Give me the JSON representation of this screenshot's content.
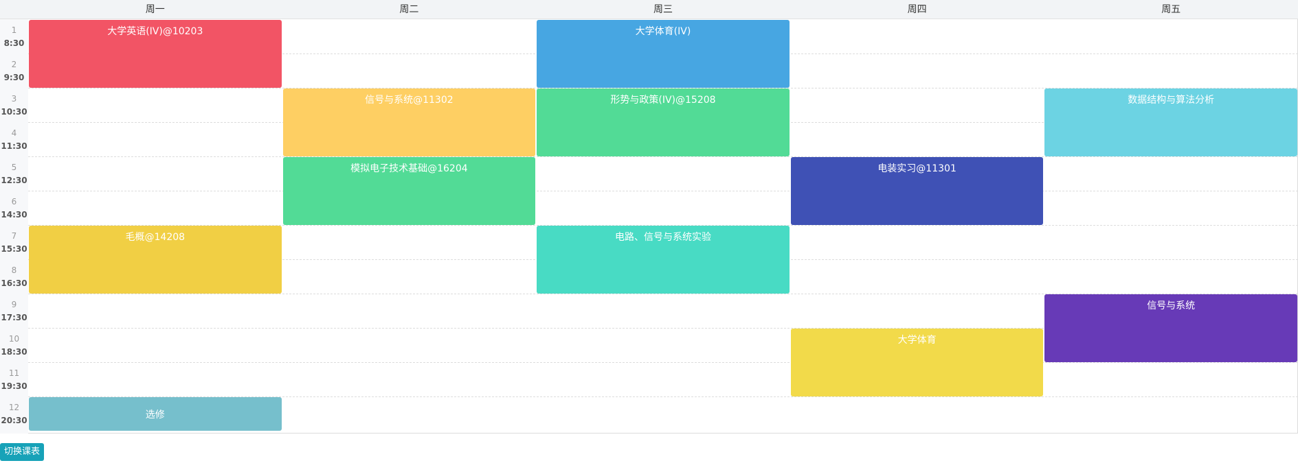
{
  "days": [
    "周一",
    "周二",
    "周三",
    "周四",
    "周五"
  ],
  "periods": [
    {
      "num": "1",
      "time": "8:30"
    },
    {
      "num": "2",
      "time": "9:30"
    },
    {
      "num": "3",
      "time": "10:30"
    },
    {
      "num": "4",
      "time": "11:30"
    },
    {
      "num": "5",
      "time": "12:30"
    },
    {
      "num": "6",
      "time": "14:30"
    },
    {
      "num": "7",
      "time": "15:30"
    },
    {
      "num": "8",
      "time": "16:30"
    },
    {
      "num": "9",
      "time": "17:30"
    },
    {
      "num": "10",
      "time": "18:30"
    },
    {
      "num": "11",
      "time": "19:30"
    },
    {
      "num": "12",
      "time": "20:30"
    }
  ],
  "courses": [
    {
      "name": "大学英语(IV)@10203",
      "day": 1,
      "start": 1,
      "span": 2,
      "color": "#f25465"
    },
    {
      "name": "信号与系统@11302",
      "day": 2,
      "start": 3,
      "span": 2,
      "color": "#fecf63"
    },
    {
      "name": "模拟电子技术基础@16204",
      "day": 2,
      "start": 5,
      "span": 2,
      "color": "#52db96"
    },
    {
      "name": "大学体育(IV)",
      "day": 3,
      "start": 1,
      "span": 2,
      "color": "#47a6e2"
    },
    {
      "name": "形势与政策(IV)@15208",
      "day": 3,
      "start": 3,
      "span": 2,
      "color": "#52db96"
    },
    {
      "name": "电路、信号与系统实验",
      "day": 3,
      "start": 7,
      "span": 2,
      "color": "#48dbc4"
    },
    {
      "name": "电装实习@11301",
      "day": 4,
      "start": 5,
      "span": 2,
      "color": "#3f51b5"
    },
    {
      "name": "大学体育",
      "day": 4,
      "start": 10,
      "span": 2,
      "color": "#f2da4a"
    },
    {
      "name": "数据结构与算法分析",
      "day": 5,
      "start": 3,
      "span": 2,
      "color": "#6cd3e3"
    },
    {
      "name": "信号与系统",
      "day": 5,
      "start": 9,
      "span": 2,
      "color": "#673ab7"
    },
    {
      "name": "毛概@14208",
      "day": 1,
      "start": 7,
      "span": 2,
      "color": "#f1cf44"
    },
    {
      "name": "选修",
      "day": 1,
      "start": 12,
      "span": 1,
      "color": "#76bfcc"
    }
  ],
  "switch_button": {
    "label": "切换课表"
  }
}
